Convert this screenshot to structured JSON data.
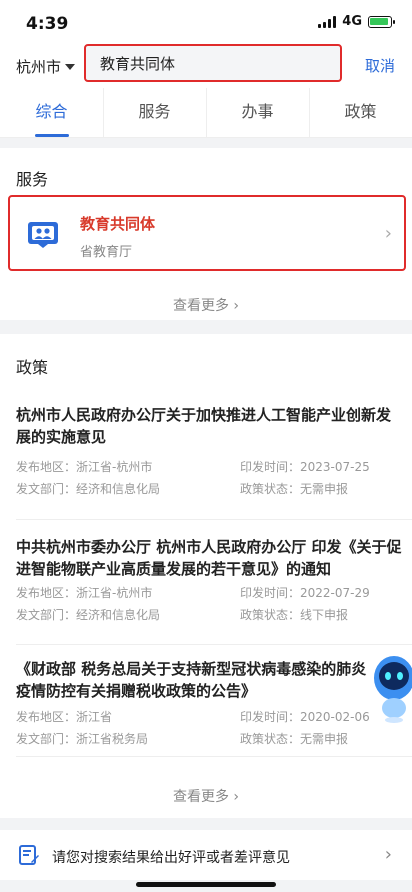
{
  "status": {
    "time": "4:39",
    "network": "4G"
  },
  "search": {
    "city": "杭州市",
    "query": "教育共同体",
    "cancel": "取消"
  },
  "tabs": [
    {
      "label": "综合",
      "active": true
    },
    {
      "label": "服务",
      "active": false
    },
    {
      "label": "办事",
      "active": false
    },
    {
      "label": "政策",
      "active": false
    }
  ],
  "services": {
    "title": "服务",
    "items": [
      {
        "name": "教育共同体",
        "department": "省教育厅"
      }
    ],
    "see_more": "查看更多"
  },
  "policies": {
    "title": "政策",
    "items": [
      {
        "title": "杭州市人民政府办公厅关于加快推进人工智能产业创新发展的实施意见",
        "region_label": "发布地区：",
        "region": "浙江省-杭州市",
        "date_label": "印发时间：",
        "date": "2023-07-25",
        "dept_label": "发文部门：",
        "dept": "经济和信息化局",
        "status_label": "政策状态：",
        "status": "无需申报"
      },
      {
        "title": "中共杭州市委办公厅 杭州市人民政府办公厅 印发《关于促进智能物联产业高质量发展的若干意见》的通知",
        "region_label": "发布地区：",
        "region": "浙江省-杭州市",
        "date_label": "印发时间：",
        "date": "2022-07-29",
        "dept_label": "发文部门：",
        "dept": "经济和信息化局",
        "status_label": "政策状态：",
        "status": "线下申报"
      },
      {
        "title": "《财政部 税务总局关于支持新型冠状病毒感染的肺炎疫情防控有关捐赠税收政策的公告》",
        "region_label": "发布地区：",
        "region": "浙江省",
        "date_label": "印发时间：",
        "date": "2020-02-06",
        "dept_label": "发文部门：",
        "dept": "浙江省税务局",
        "status_label": "政策状态：",
        "status": "无需申报"
      }
    ],
    "see_more": "查看更多"
  },
  "feedback": {
    "text": "请您对搜索结果给出好评或者差评意见"
  },
  "colors": {
    "accent": "#2d6bd8",
    "highlight": "#e02b2b",
    "service_name": "#d83a2b"
  }
}
